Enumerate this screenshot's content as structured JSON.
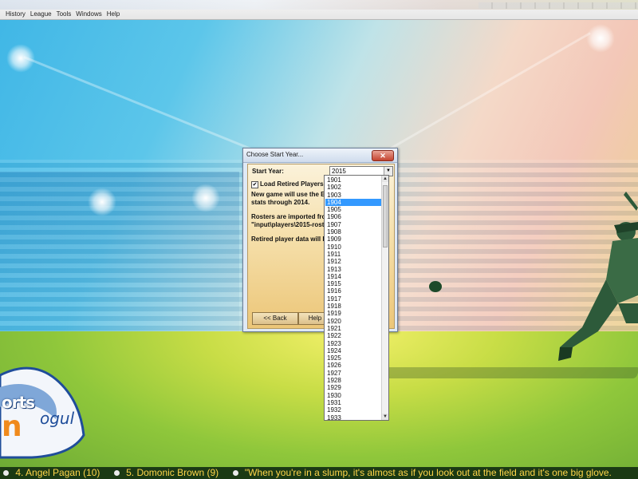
{
  "menu": {
    "items": [
      "History",
      "League",
      "Tools",
      "Windows",
      "Help"
    ]
  },
  "logo": {
    "line1": "orts",
    "line2": "ogul",
    "letter": "n"
  },
  "dialog": {
    "title": "Choose Start Year...",
    "close_label": "✕",
    "start_year_label": "Start Year:",
    "start_year_value": "2015",
    "load_retired_label": "Load Retired Players",
    "load_retired_checked": true,
    "info_1": "New game will use the B",
    "info_2": "stats through 2014.",
    "info_3": "Rosters are imported from",
    "info_4": "\"input\\players\\2015-roster",
    "info_5": "Retired player data will b",
    "back_button": "<< Back",
    "help_button": "Help"
  },
  "year_list": {
    "years": [
      "1901",
      "1902",
      "1903",
      "1904",
      "1905",
      "1906",
      "1907",
      "1908",
      "1909",
      "1910",
      "1911",
      "1912",
      "1913",
      "1914",
      "1915",
      "1916",
      "1917",
      "1918",
      "1919",
      "1920",
      "1921",
      "1922",
      "1923",
      "1924",
      "1925",
      "1926",
      "1927",
      "1928",
      "1929",
      "1930",
      "1931",
      "1932",
      "1933"
    ],
    "selected": "1904"
  },
  "ticker": {
    "items": [
      "4. Angel Pagan (10)",
      "5. Domonic Brown (9)",
      "\"When you're in a slump, it's almost as if you look out at the field and it's one big glove."
    ]
  },
  "colors": {
    "ticker_bg": "#1b3a14",
    "ticker_text": "#ffd54a",
    "selection": "#3399ff"
  }
}
